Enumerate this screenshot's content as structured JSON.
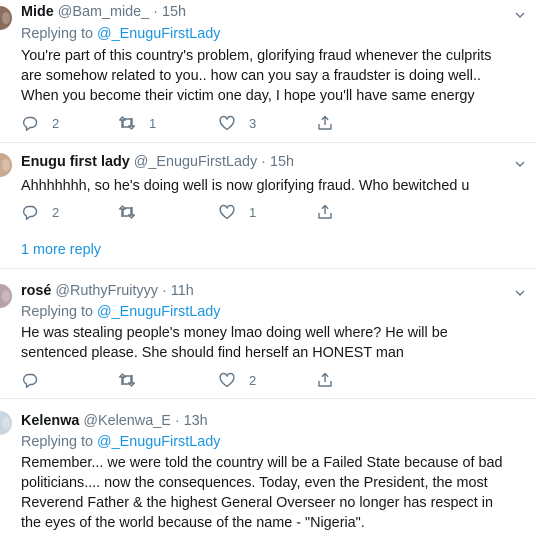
{
  "tweets": [
    {
      "name": "Mide",
      "handle": "@Bam_mide_",
      "sep": "·",
      "time": "15h",
      "replying_prefix": "Replying to ",
      "replying_handle": "",
      "lines": [
        "You're part of this country's problem, glorifying fraud whenever the culprits",
        "are somehow related to you.. how can you say a fraudster is doing well..",
        "When you become their victim one day, I hope you'll have same energy"
      ],
      "replies": "2",
      "retweets": "1",
      "likes": "3"
    },
    {
      "name": "Enugu first lady",
      "handle": "@_EnuguFirstLady",
      "sep": "·",
      "time": "15h",
      "lines": [
        "Ahhhhhhh, so he's doing well is now glorifying fraud.  Who bewitched u"
      ],
      "replies": "2",
      "retweets": "",
      "likes": "1",
      "more_replies": "1 more reply"
    },
    {
      "name": "rosé",
      "handle": "@RuthyFruityyy",
      "sep": "·",
      "time": "11h",
      "replying_prefix": "Replying to ",
      "replying_handle": "@_EnuguFirstLady",
      "lines": [
        "He was stealing people's money lmao doing well where? He will be",
        "sentenced please. She should find herself an HONEST man"
      ],
      "replies": "",
      "retweets": "",
      "likes": "2"
    },
    {
      "name": "Kelenwa",
      "handle": "@Kelenwa_E",
      "sep": "·",
      "time": "13h",
      "replying_prefix": "Replying to ",
      "replying_handle": "@_EnuguFirstLady",
      "lines": [
        "Remember... we were told the country will be a Failed State because of bad",
        "politicians.... now the consequences. Today, even the President, the most",
        "Reverend Father & the highest General Overseer no longer has respect in",
        "the eyes of the world because of the name - \"Nigeria\"."
      ]
    }
  ],
  "t1_reply_handle": "@_EnuguFirstLady",
  "icons": [
    "reply-icon",
    "retweet-icon",
    "like-icon",
    "share-icon",
    "caret-down-icon"
  ],
  "colors": {
    "link": "#1b95e0",
    "muted": "#657786",
    "text": "#14171a",
    "divider": "#e6ecf0"
  }
}
